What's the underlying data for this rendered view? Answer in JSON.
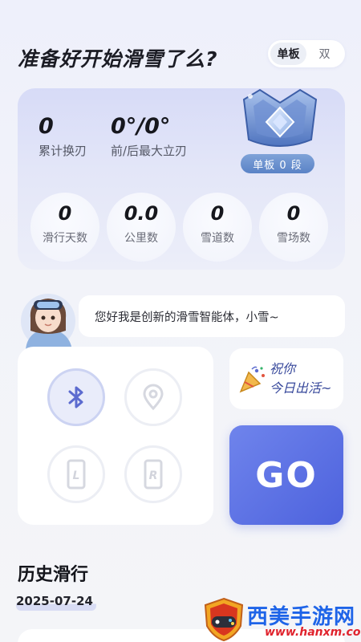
{
  "header": {
    "title": "准备好开始滑雪了么?",
    "mode_options": [
      "单板",
      "双"
    ],
    "active_mode": "单板"
  },
  "stats": {
    "edge_changes": {
      "value": "0",
      "label": "累计换刃"
    },
    "max_edge": {
      "value": "0°/0°",
      "label": "前/后最大立刃"
    },
    "rank_badge": "单板 0 段",
    "circles": [
      {
        "value": "0",
        "label": "滑行天数"
      },
      {
        "value": "0.0",
        "label": "公里数"
      },
      {
        "value": "0",
        "label": "雪道数"
      },
      {
        "value": "0",
        "label": "雪场数"
      }
    ]
  },
  "assistant": {
    "message": "您好我是创新的滑雪智能体，小雪~"
  },
  "devices": {
    "icons": [
      "bluetooth-icon",
      "location-pin-icon",
      "left-board-icon",
      "right-board-icon"
    ],
    "left_letter": "L",
    "right_letter": "R"
  },
  "greeting": {
    "line1": "祝你",
    "line2": "今日出活~"
  },
  "go_label": "GO",
  "history": {
    "title": "历史滑行",
    "date": "2025-07-24"
  },
  "watermark": {
    "title": "西美手游网",
    "url": "www.hanxm.com"
  },
  "colors": {
    "accent": "#5a6fe4",
    "icon_blue": "#5c6bcf",
    "watermark_blue": "#1e64e8",
    "watermark_red": "#e0232d"
  }
}
